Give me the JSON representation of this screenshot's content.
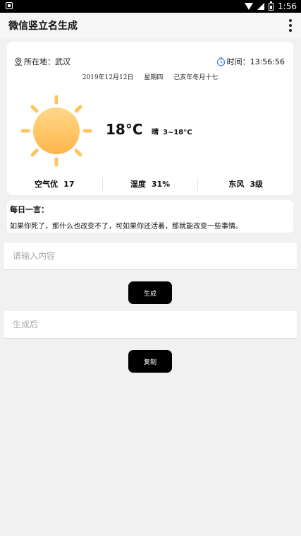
{
  "statusbar": {
    "time": "1:56"
  },
  "app": {
    "title": "微信竖立名生成"
  },
  "weather": {
    "location_label": "所在地：武汉",
    "time_label": "时间：13:56:56",
    "date": "2019年12月12日",
    "weekday": "星期四",
    "lunar": "己亥年冬月十七",
    "temperature": "18°C",
    "condition": "晴",
    "range": "3~18°C",
    "stats": [
      {
        "label": "空气优",
        "value": "17"
      },
      {
        "label": "湿度",
        "value": "31%"
      },
      {
        "label": "东风",
        "value": "3级"
      }
    ],
    "sun_color": "#FFC45C"
  },
  "quote": {
    "title": "每日一言：",
    "text": "如果你死了，那什么也改变不了，可如果你还活着，那就能改变一些事情。"
  },
  "input": {
    "placeholder": "请输入内容",
    "value": ""
  },
  "generate_button": "生成",
  "output": {
    "placeholder": "生成后",
    "value": ""
  },
  "copy_button": "复制"
}
